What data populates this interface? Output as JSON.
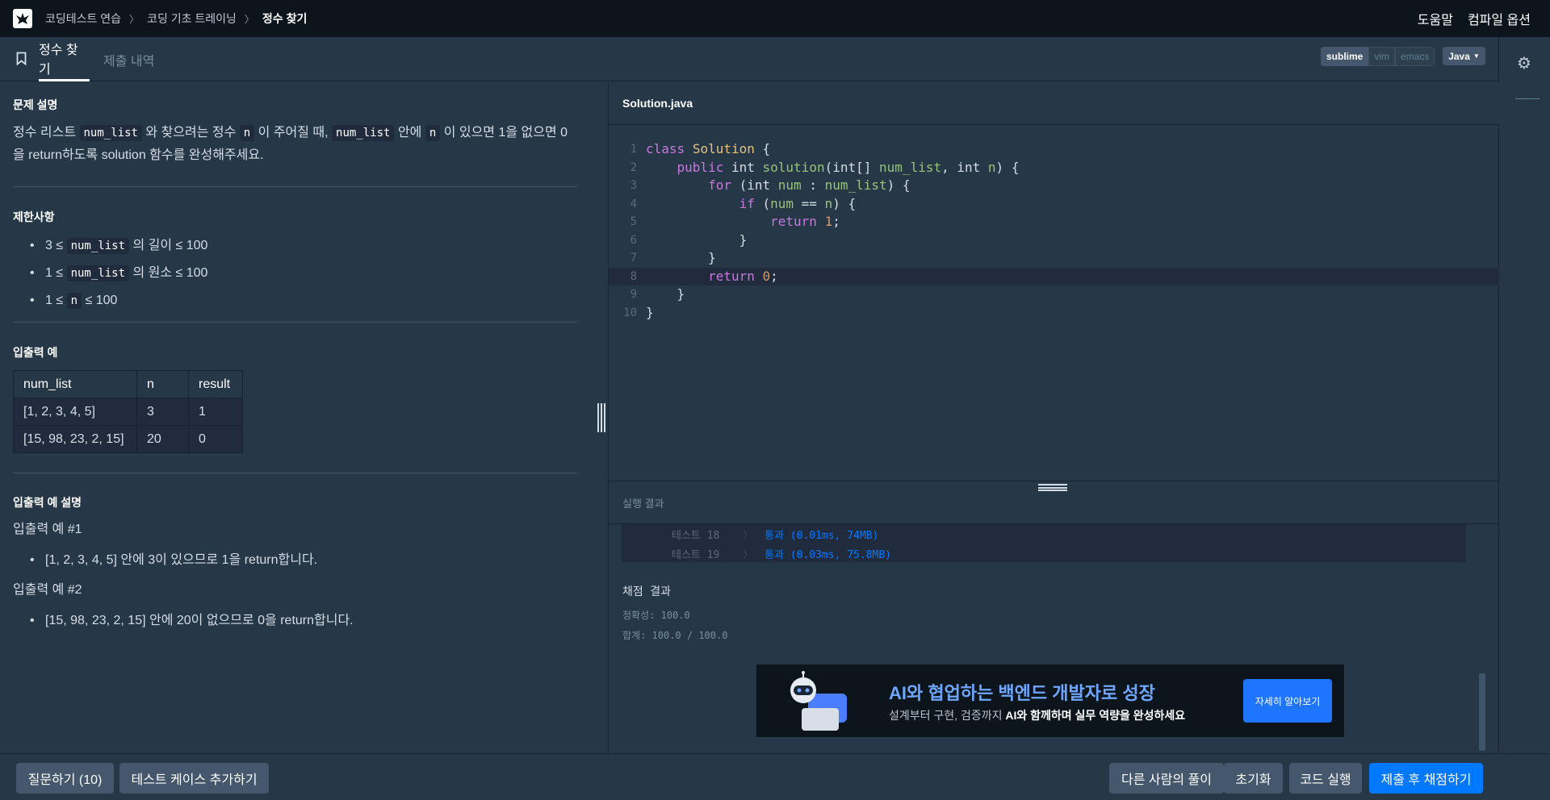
{
  "topnav": {
    "breadcrumbs": [
      "코딩테스트 연습",
      "코딩 기초 트레이닝",
      "정수 찾기"
    ],
    "help": "도움말",
    "compile_options": "컴파일 옵션"
  },
  "tabs": {
    "problem": "정수 찾기",
    "submissions": "제출 내역"
  },
  "editor_modes": [
    "sublime",
    "vim",
    "emacs"
  ],
  "language": "Java",
  "problem": {
    "desc_title": "문제 설명",
    "desc_part1": "정수 리스트 ",
    "desc_code1": "num_list",
    "desc_part2": " 와 찾으려는 정수 ",
    "desc_code2": "n",
    "desc_part3": " 이 주어질 때, ",
    "desc_code3": "num_list",
    "desc_part4": " 안에 ",
    "desc_code4": "n",
    "desc_part5": " 이 있으면 1을 없으면 0",
    "desc_line2": "을 return하도록 solution 함수를 완성해주세요.",
    "limits_title": "제한사항",
    "limits": [
      {
        "pre": "3 ≤ ",
        "code": "num_list",
        "post": " 의 길이 ≤ 100"
      },
      {
        "pre": "1 ≤ ",
        "code": "num_list",
        "post": " 의 원소 ≤ 100"
      },
      {
        "pre": "1 ≤ ",
        "code": "n",
        "post": " ≤ 100"
      }
    ],
    "io_title": "입출력 예",
    "io_headers": [
      "num_list",
      "n",
      "result"
    ],
    "io_rows": [
      [
        "[1, 2, 3, 4, 5]",
        "3",
        "1"
      ],
      [
        "[15, 98, 23, 2, 15]",
        "20",
        "0"
      ]
    ],
    "explain_title": "입출력 예 설명",
    "ex1_title": "입출력 예 #1",
    "ex1_item": "[1, 2, 3, 4, 5] 안에 3이 있으므로 1을 return합니다.",
    "ex2_title": "입출력 예 #2",
    "ex2_item": "[15, 98, 23, 2, 15] 안에 20이 없으므로 0을 return합니다."
  },
  "editor": {
    "filename": "Solution.java",
    "line_numbers": [
      "1",
      "2",
      "3",
      "4",
      "5",
      "6",
      "7",
      "8",
      "9",
      "10"
    ]
  },
  "results": {
    "title": "실행 결과",
    "tests": [
      {
        "label": "테스트 18",
        "arrow": "〉",
        "result": "통과 (0.01ms, 74MB)"
      },
      {
        "label": "테스트 19",
        "arrow": "〉",
        "result": "통과 (0.03ms, 75.8MB)"
      }
    ],
    "grade_title": "채점 결과",
    "accuracy": "정확성: 100.0",
    "total": "합계: 100.0 / 100.0"
  },
  "banner": {
    "title": "AI와 협업하는 백엔드 개발자로 성장",
    "sub_pre": "설계부터 구현, 검증까지 ",
    "sub_bold": "AI와 함께하며 실무 역량을 완성하세요",
    "button": "자세히 알아보기"
  },
  "bottom": {
    "ask": "질문하기 (10)",
    "add_testcase": "테스트 케이스 추가하기",
    "others": "다른 사람의 풀이",
    "reset": "초기화",
    "run": "코드 실행",
    "submit": "제출 후 채점하기"
  },
  "colors": {
    "background": "#263747",
    "topnav": "#0c151c",
    "primary": "#0078ff",
    "button": "#44576c"
  }
}
